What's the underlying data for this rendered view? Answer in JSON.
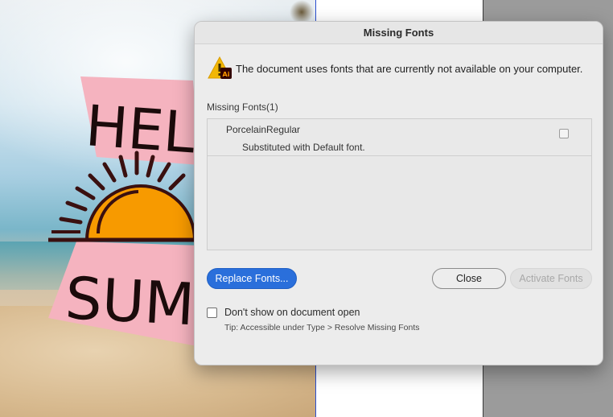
{
  "dialog": {
    "title": "Missing Fonts",
    "message": "The document uses fonts that are currently not available on your computer.",
    "warning_icon_badge": "Ai",
    "missing_fonts_label": "Missing Fonts(1)",
    "fonts": [
      {
        "name": "PorcelainRegular",
        "status": "Substituted with Default font.",
        "checked": false
      }
    ],
    "buttons": {
      "replace": "Replace Fonts...",
      "close": "Close",
      "activate": "Activate Fonts"
    },
    "dont_show_label": "Don't show on document open",
    "dont_show_checked": false,
    "tip": "Tip: Accessible under Type > Resolve Missing Fonts"
  },
  "colors": {
    "primary_button": "#2a6fdb",
    "warning_yellow": "#f2b705",
    "ai_badge": "#330000",
    "ai_badge_text": "#ff9a00"
  },
  "icons": {
    "warning": "warning-triangle-icon",
    "ai_badge": "illustrator-badge-icon"
  },
  "artwork": {
    "text_top": "HELLO",
    "text_bottom": "SUMMER"
  }
}
